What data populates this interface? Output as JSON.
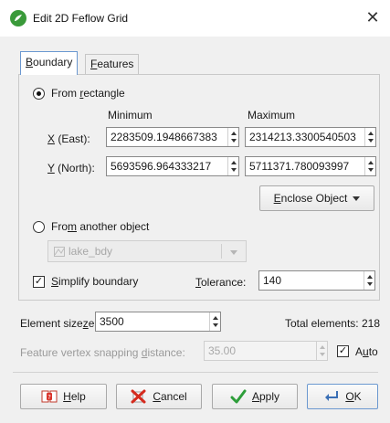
{
  "window": {
    "title": "Edit 2D Feflow Grid"
  },
  "tabs": [
    {
      "label": "Boundary",
      "accel": "B",
      "rest": "oundary"
    },
    {
      "label": "Features",
      "accel": "F",
      "rest": "eatures"
    }
  ],
  "boundary": {
    "from_rectangle": {
      "pre": "From ",
      "accel": "r",
      "post": "ectangle",
      "selected": true
    },
    "col_min": "Minimum",
    "col_max": "Maximum",
    "x_label": {
      "accel": "X",
      "post": " (East):"
    },
    "y_label": {
      "accel": "Y",
      "post": " (North):"
    },
    "x_min": "2283509.1948667383",
    "x_max": "2314213.3300540503",
    "y_min": "5693596.964333217",
    "y_max": "5711371.780093997",
    "enclose": {
      "accel": "E",
      "post": "nclose Object"
    },
    "from_object": {
      "pre": "Fro",
      "accel": "m",
      "post": " another object",
      "selected": false
    },
    "object_value": "lake_bdy",
    "simplify": {
      "accel": "S",
      "post": "implify boundary",
      "checked": true
    },
    "tolerance_label": {
      "accel": "T",
      "post": "olerance:"
    },
    "tolerance_value": "140"
  },
  "element_size": {
    "pre": "Element size",
    "accel": "z",
    "post": "e:",
    "value": "3500"
  },
  "total_elements": "Total elements: 218",
  "snapping": {
    "pre": "Feature vertex snapping ",
    "accel": "d",
    "post": "istance:",
    "value": "35.00"
  },
  "auto": {
    "pre": "A",
    "accel": "u",
    "post": "to",
    "checked": true
  },
  "buttons": {
    "help": {
      "accel": "H",
      "post": "elp"
    },
    "cancel": {
      "accel": "C",
      "post": "ancel"
    },
    "apply": {
      "accel": "A",
      "post": "pply"
    },
    "ok": {
      "accel": "O",
      "post": "K"
    }
  },
  "colors": {
    "accent_tab": "#6b98d0",
    "app_icon": "#3a9a3a"
  }
}
